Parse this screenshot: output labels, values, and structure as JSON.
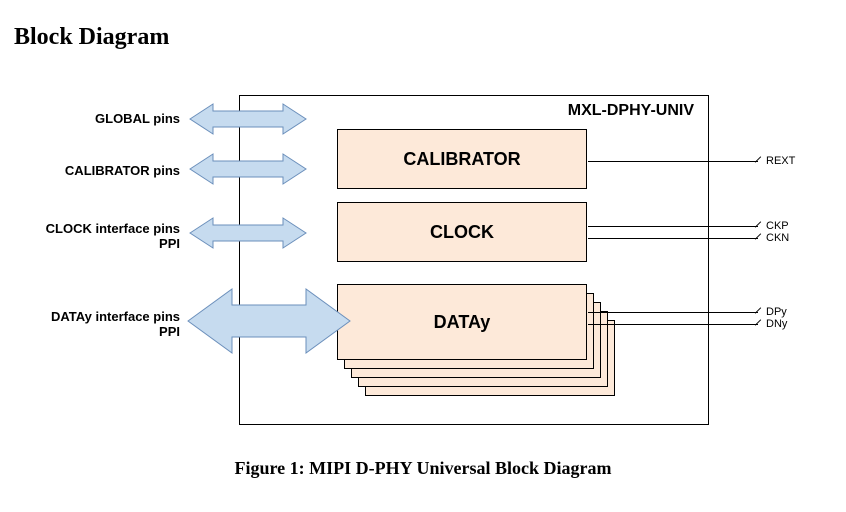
{
  "section_title": "Block Diagram",
  "caption": "Figure 1: MIPI D-PHY Universal Block Diagram",
  "block_name": "MXL-DPHY-UNIV",
  "modules": {
    "calibrator": "CALIBRATOR",
    "clock": "CLOCK",
    "data": "DATAy"
  },
  "left_labels": {
    "global": "GLOBAL pins",
    "calibrator": "CALIBRATOR pins",
    "clock_line1": "CLOCK interface pins",
    "clock_line2": "PPI",
    "data_line1": "DATAy interface pins",
    "data_line2": "PPI"
  },
  "right_pins": {
    "rext": "REXT",
    "ckp": "CKP",
    "ckn": "CKN",
    "dpy": "DPy",
    "dny": "DNy"
  },
  "colors": {
    "module_fill": "#fde9d9",
    "arrow_fill": "#c6dbef",
    "arrow_stroke": "#6b8fbb"
  }
}
